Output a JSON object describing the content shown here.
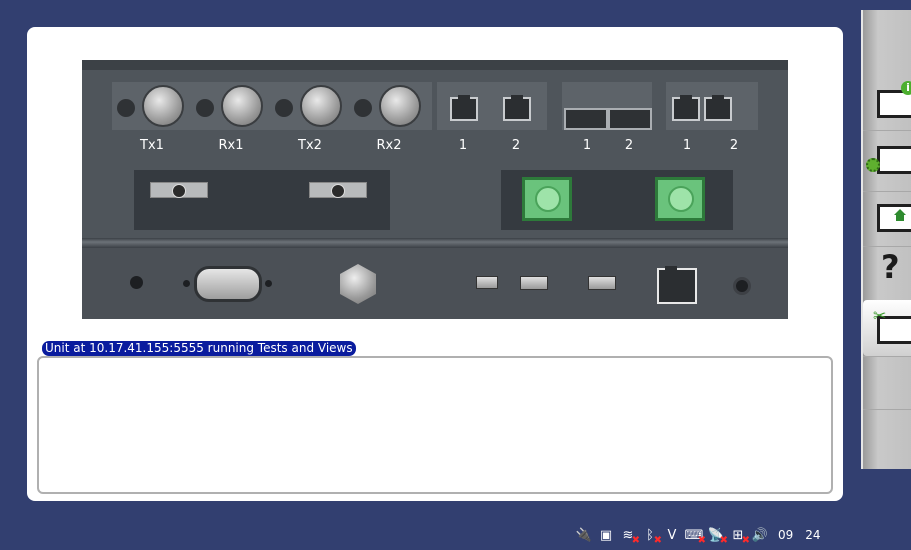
{
  "device": {
    "bnc_labels": [
      "Tx1",
      "Rx1",
      "Tx2",
      "Rx2"
    ],
    "rj45_group_a_labels": [
      "1",
      "2"
    ],
    "sfp_group_labels": [
      "1",
      "2"
    ],
    "rj45_group_b_labels": [
      "1",
      "2"
    ]
  },
  "status": {
    "message": "Unit at 10.17.41.155:5555 running Tests and Views"
  },
  "sidebar": {
    "items": [
      {
        "name": "info",
        "icon": "info-folder-icon"
      },
      {
        "name": "settings",
        "icon": "settings-folder-icon"
      },
      {
        "name": "home",
        "icon": "home-folder-icon"
      },
      {
        "name": "help",
        "icon": "help-icon",
        "label": "?"
      },
      {
        "name": "tools",
        "icon": "tools-folder-icon"
      }
    ]
  },
  "tray": {
    "clock_hour": "09",
    "clock_minute": "24"
  },
  "colors": {
    "background": "#323f70",
    "status_label_bg": "#0a1c9e",
    "sfp_green": "#6ac37c"
  }
}
